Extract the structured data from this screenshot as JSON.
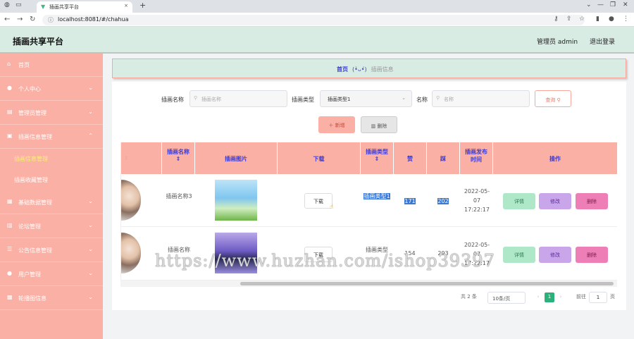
{
  "browser": {
    "tab_title": "插画共享平台",
    "url": "localhost:8081/#/chahua"
  },
  "header": {
    "brand": "插画共享平台",
    "admin": "管理员 admin",
    "logout": "退出登录"
  },
  "sidebar": {
    "items": [
      {
        "label": "首页",
        "icon": "home-icon",
        "chev": false
      },
      {
        "label": "个人中心",
        "icon": "user-icon",
        "chev": true
      },
      {
        "label": "管理员管理",
        "icon": "admin-icon",
        "chev": true
      },
      {
        "label": "插画信息管理",
        "icon": "doc-icon",
        "chev": true,
        "open": true
      },
      {
        "label": "基础数据管理",
        "icon": "data-icon",
        "chev": true
      },
      {
        "label": "论坛管理",
        "icon": "chart-icon",
        "chev": true
      },
      {
        "label": "公告信息管理",
        "icon": "list-icon",
        "chev": true
      },
      {
        "label": "用户管理",
        "icon": "user-icon",
        "chev": true
      },
      {
        "label": "轮播图信息",
        "icon": "image-icon",
        "chev": true
      }
    ],
    "subitems": [
      "插画信息管理",
      "插画收藏管理"
    ]
  },
  "breadcrumb": {
    "home": "首页",
    "face": "(•̀ᴗ•́)",
    "current": "插画信息"
  },
  "search": {
    "name_label": "插画名称",
    "name_placeholder": "插画名称",
    "type_label": "插画类型",
    "type_value": "插画类型1",
    "author_label": "名称",
    "author_placeholder": "名称",
    "query_button": "查询"
  },
  "actions": {
    "add": "新增",
    "delete": "删除"
  },
  "table": {
    "headers": [
      "插画名称",
      "插画图片",
      "下载",
      "插画类型",
      "赞",
      "踩",
      "插画发布时间",
      "操作"
    ],
    "rows": [
      {
        "name": "插画名称3",
        "download": "下载",
        "type": "插画类型1",
        "up": "171",
        "down": "202",
        "date": "2022-05-07 17:22:17"
      },
      {
        "name": "插画名称",
        "download": "下载",
        "type": "插画类型",
        "up": "154",
        "down": "293",
        "date": "2022-05-07 17:22:17"
      }
    ],
    "op_detail": "详情",
    "op_edit": "修改",
    "op_delete": "删除"
  },
  "pager": {
    "total": "共 2 条",
    "size": "10条/页",
    "page": "1",
    "goto": "前往",
    "goto_val": "1",
    "unit": "页"
  },
  "watermark": "https://www.huzhan.com/ishop39397",
  "colors": {
    "sidebar": "#fab0a5",
    "topbar": "#d8ece4",
    "header_cell": "#fab0a5",
    "accent": "#3b3bd8"
  }
}
